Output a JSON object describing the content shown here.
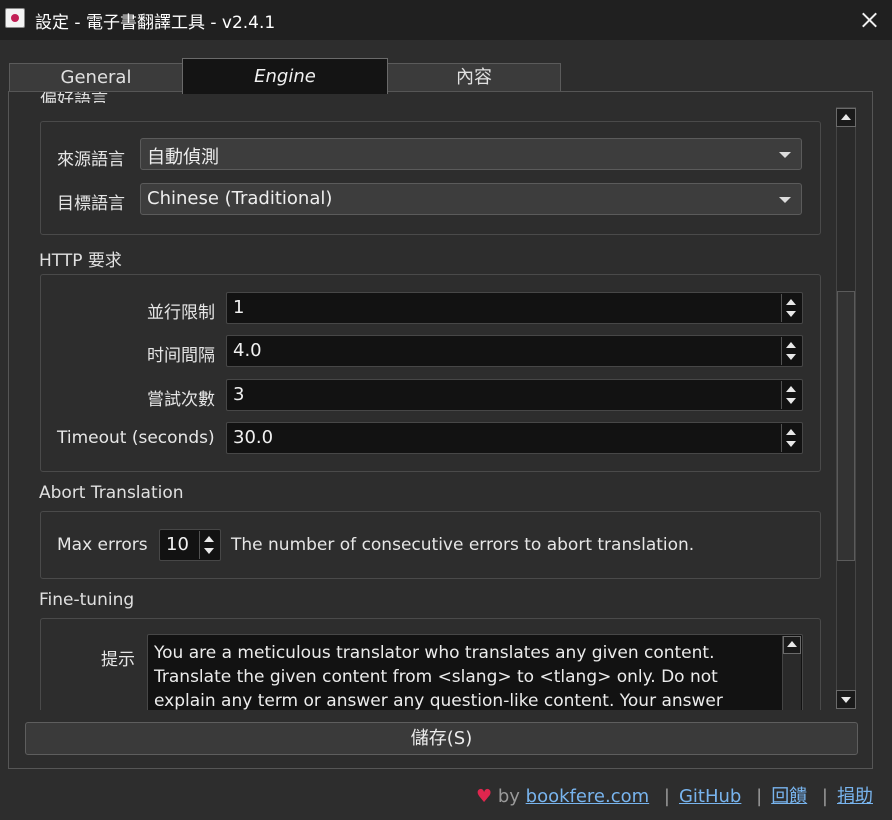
{
  "window": {
    "title": "設定 - 電子書翻譯工具 - v2.4.1"
  },
  "tabs": [
    {
      "label": "General",
      "active": false
    },
    {
      "label": "Engine",
      "active": true
    },
    {
      "label": "內容",
      "active": false
    }
  ],
  "language_group": {
    "title": "偏好語言",
    "source_label": "來源語言",
    "source_value": "自動偵測",
    "target_label": "目標語言",
    "target_value": "Chinese (Traditional)"
  },
  "http": {
    "title": "HTTP 要求",
    "concurrency_label": "並行限制",
    "concurrency_value": "1",
    "interval_label": "时间間隔",
    "interval_value": "4.0",
    "retry_label": "嘗試次數",
    "retry_value": "3",
    "timeout_label": "Timeout (seconds)",
    "timeout_value": "30.0"
  },
  "abort": {
    "title": "Abort Translation",
    "max_errors_label": "Max errors",
    "max_errors_value": "10",
    "description": "The number of consecutive errors to abort translation."
  },
  "finetune": {
    "title": "Fine-tuning",
    "prompt_label": "提示",
    "prompt_text": "You are a meticulous translator who translates any given content. Translate the given content from <slang> to <tlang> only. Do not explain any term or answer any question-like content. Your answer"
  },
  "save_button": {
    "label": "儲存(S)"
  },
  "footer": {
    "by": "by",
    "site": "bookfere.com",
    "github": "GitHub",
    "feedback": "回饋",
    "donate": "捐助",
    "separator": "|",
    "heart": "♥"
  },
  "colors": {
    "accent_link": "#78b4ee",
    "heart": "#e0264e",
    "panel_bg": "#2d2d2d",
    "field_bg": "#121212"
  }
}
